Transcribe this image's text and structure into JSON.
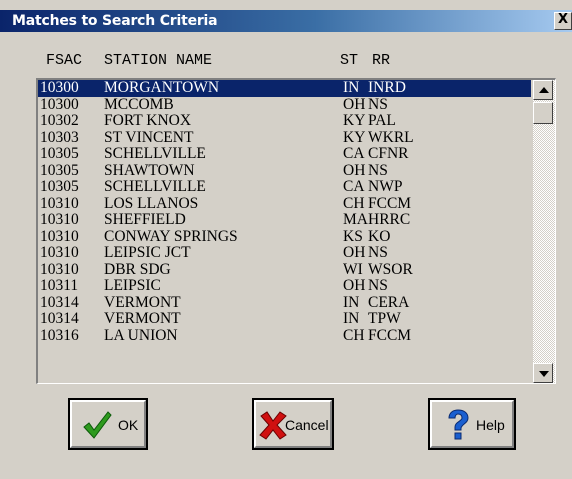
{
  "window": {
    "title": "Matches to Search Criteria",
    "close_label": "X"
  },
  "columns": {
    "fsac": "FSAC",
    "station_name": "STATION NAME",
    "st": "ST",
    "rr": "RR"
  },
  "rows": [
    {
      "fsac": "10300",
      "name": "MORGANTOWN",
      "st": "IN",
      "rr": "INRD"
    },
    {
      "fsac": "10300",
      "name": "MCCOMB",
      "st": "OH",
      "rr": "NS"
    },
    {
      "fsac": "10302",
      "name": "FORT KNOX",
      "st": "KY",
      "rr": "PAL"
    },
    {
      "fsac": "10303",
      "name": "ST VINCENT",
      "st": "KY",
      "rr": "WKRL"
    },
    {
      "fsac": "10305",
      "name": "SCHELLVILLE",
      "st": "CA",
      "rr": "CFNR"
    },
    {
      "fsac": "10305",
      "name": "SHAWTOWN",
      "st": "OH",
      "rr": "NS"
    },
    {
      "fsac": "10305",
      "name": "SCHELLVILLE",
      "st": "CA",
      "rr": "NWP"
    },
    {
      "fsac": "10310",
      "name": "LOS LLANOS",
      "st": "CH",
      "rr": "FCCM"
    },
    {
      "fsac": "10310",
      "name": "SHEFFIELD",
      "st": "MA",
      "rr": "HRRC"
    },
    {
      "fsac": "10310",
      "name": "CONWAY SPRINGS",
      "st": "KS",
      "rr": "KO"
    },
    {
      "fsac": "10310",
      "name": "LEIPSIC JCT",
      "st": "OH",
      "rr": "NS"
    },
    {
      "fsac": "10310",
      "name": "DBR SDG",
      "st": "WI",
      "rr": "WSOR"
    },
    {
      "fsac": "10311",
      "name": "LEIPSIC",
      "st": "OH",
      "rr": "NS"
    },
    {
      "fsac": "10314",
      "name": "VERMONT",
      "st": "IN",
      "rr": "CERA"
    },
    {
      "fsac": "10314",
      "name": "VERMONT",
      "st": "IN",
      "rr": "TPW"
    },
    {
      "fsac": "10316",
      "name": "LA UNION",
      "st": "CH",
      "rr": "FCCM"
    }
  ],
  "selected_row": 0,
  "buttons": {
    "ok": "OK",
    "cancel": "Cancel",
    "help": "Help"
  },
  "icons": {
    "ok": "checkmark-icon",
    "cancel": "red-x-icon",
    "help": "question-mark-icon"
  },
  "colors": {
    "title_bar": "#0a246a",
    "selection": "#0a246a",
    "dialog": "#d4d0c8"
  }
}
